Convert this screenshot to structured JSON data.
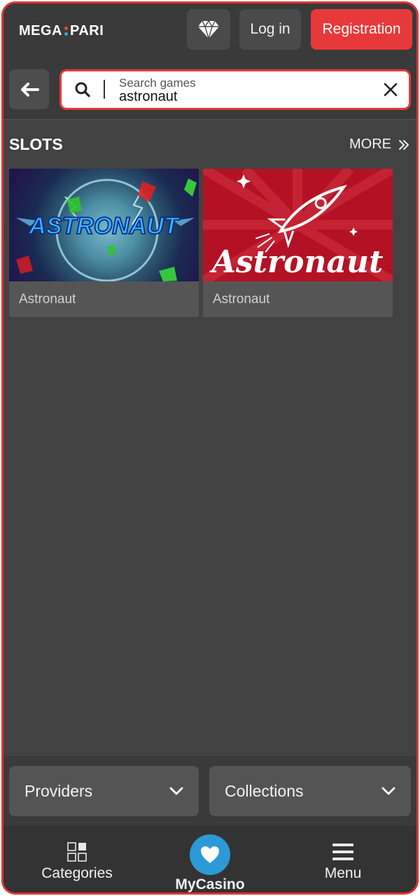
{
  "header": {
    "logo_left": "MEGA",
    "logo_right": "PARI",
    "login_label": "Log in",
    "register_label": "Registration",
    "colors": {
      "accent": "#e8393a",
      "brand_dot_red": "#e8443a",
      "brand_dot_blue": "#2fa2e0"
    }
  },
  "search": {
    "placeholder": "Search games",
    "value": "astronaut"
  },
  "section": {
    "title": "SLOTS",
    "more_label": "MORE"
  },
  "games": [
    {
      "title": "Astronaut",
      "art_text": "ASTRONAUT"
    },
    {
      "title": "Astronaut",
      "art_text": "Astronaut"
    }
  ],
  "filters": {
    "providers_label": "Providers",
    "collections_label": "Collections"
  },
  "nav": {
    "categories_label": "Categories",
    "mycasino_label": "MyCasino",
    "menu_label": "Menu",
    "mycasino_color": "#2b9ad6"
  }
}
